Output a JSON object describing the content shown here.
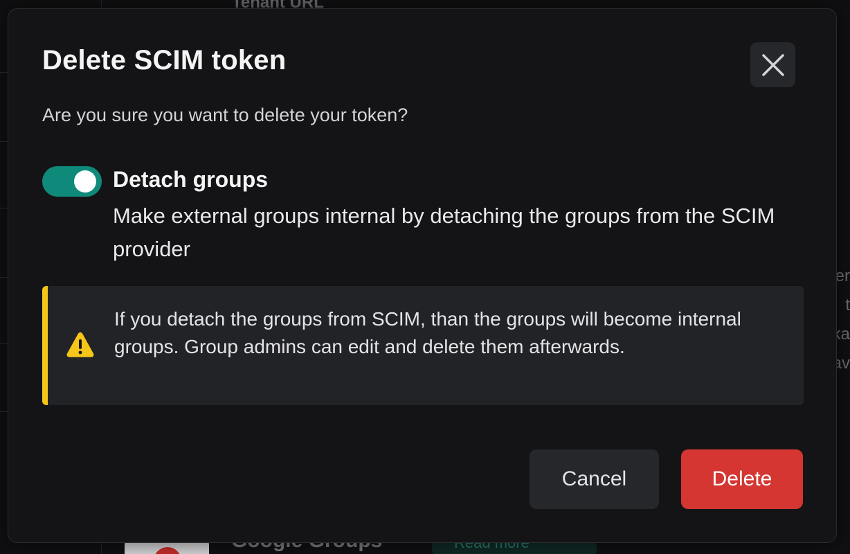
{
  "background": {
    "tenant_label": "Tenant URL",
    "right_snippets": [
      "er",
      "t",
      "ka",
      "av"
    ],
    "google_title": "Google Groups",
    "read_more_label": "Read more"
  },
  "dialog": {
    "title": "Delete SCIM token",
    "close_icon": "close-icon",
    "question": "Are you sure you want to delete your token?",
    "toggle": {
      "state": "on",
      "label": "Detach groups",
      "description": "Make external groups internal by detaching the groups from the SCIM provider"
    },
    "warning": {
      "icon": "warning-triangle-icon",
      "text": "If you detach the groups from SCIM, than the groups will become internal groups. Group admins can edit and delete them afterwards."
    },
    "buttons": {
      "cancel": "Cancel",
      "delete": "Delete"
    }
  },
  "colors": {
    "toggle_on": "#0f8a7a",
    "warning_accent": "#f5c518",
    "danger": "#d53632",
    "modal_bg": "#141416"
  }
}
